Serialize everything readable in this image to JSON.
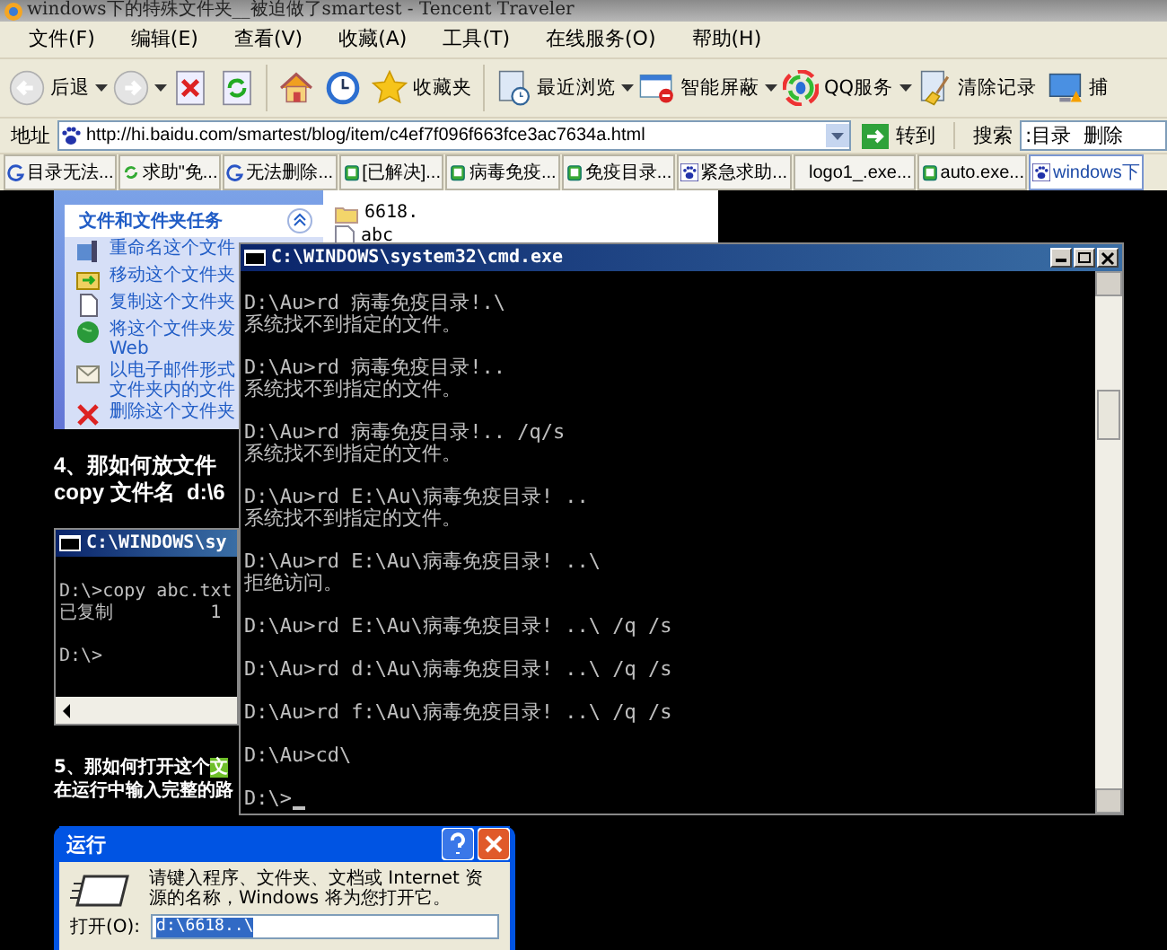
{
  "window": {
    "title": "windows下的特殊文件夹__被迫做了smartest - Tencent Traveler"
  },
  "menu": [
    "文件(F)",
    "编辑(E)",
    "查看(V)",
    "收藏(A)",
    "工具(T)",
    "在线服务(O)",
    "帮助(H)"
  ],
  "toolbar": [
    {
      "kind": "back",
      "label": "后退",
      "dropdown": true
    },
    {
      "kind": "forward",
      "dropdown": true
    },
    {
      "kind": "stop",
      "dropdown": false
    },
    {
      "kind": "refresh",
      "dropdown": false
    },
    {
      "kind": "home",
      "dropdown": false
    },
    {
      "kind": "history",
      "dropdown": false
    },
    {
      "kind": "favorites",
      "label": "收藏夹",
      "dropdown": false
    },
    {
      "kind": "recent",
      "label": "最近浏览",
      "dropdown": true
    },
    {
      "kind": "block",
      "label": "智能屏蔽",
      "dropdown": true
    },
    {
      "kind": "qq",
      "label": "QQ服务",
      "dropdown": true
    },
    {
      "kind": "clear",
      "label": "清除记录",
      "dropdown": false
    },
    {
      "kind": "capture",
      "label": "捕",
      "dropdown": false
    }
  ],
  "address_bar": {
    "label": "地址",
    "url": "http://hi.baidu.com/smartest/blog/item/c4ef7f096f663fce3ac7634a.html",
    "go": "转到",
    "search_label": "搜索",
    "search_value": ":目录  删除"
  },
  "tabs": [
    {
      "kind": "g",
      "label": "目录无法...",
      "selected": false
    },
    {
      "kind": "recycle",
      "label": "求助\"免...",
      "selected": false
    },
    {
      "kind": "g",
      "label": "无法删除...",
      "selected": false
    },
    {
      "kind": "page",
      "label": "[已解决]...",
      "selected": false
    },
    {
      "kind": "page",
      "label": "病毒免疫...",
      "selected": false
    },
    {
      "kind": "page",
      "label": "免疫目录...",
      "selected": false
    },
    {
      "kind": "paw",
      "label": "紧急求助...",
      "selected": false
    },
    {
      "kind": "none",
      "label": "logo1_.exe...",
      "selected": false
    },
    {
      "kind": "page",
      "label": "auto.exe...",
      "selected": false
    },
    {
      "kind": "paw",
      "label": "windows下",
      "selected": true
    }
  ],
  "article": {
    "explorer": {
      "task_header": "文件和文件夹任务",
      "expanded": true,
      "tasks": [
        {
          "kind": "rename",
          "label": "重命名这个文件"
        },
        {
          "kind": "move",
          "label": "移动这个文件夹"
        },
        {
          "kind": "copy",
          "label": "复制这个文件夹"
        },
        {
          "kind": "web",
          "label": "将这个文件夹发",
          "label_2": "Web"
        },
        {
          "kind": "email",
          "label": "以电子邮件形式",
          "label_2": "文件夹内的文件"
        },
        {
          "kind": "delete",
          "label": "删除这个文件夹"
        }
      ],
      "files": [
        {
          "kind": "folder",
          "name": "6618."
        },
        {
          "kind": "file",
          "name": "abc"
        }
      ]
    },
    "step4": {
      "heading": "4、那如何放文件",
      "command": "copy 文件名  d:\\6"
    },
    "small_console": {
      "title": "C:\\WINDOWS\\sy",
      "blocks": [
        [
          "D:\\>copy abc.txt",
          "已复制         1"
        ],
        [
          "D:\\>"
        ]
      ]
    },
    "step5": {
      "line_1": "5、那如何打开这个",
      "highlight": "文",
      "line_2": "在运行中输入完整的路"
    },
    "run_dialog": {
      "title": "运行",
      "prompt": "请键入程序、文件夹、文档或 Internet 资源的名称，Windows 将为您打开它。",
      "open_label": "打开(O):",
      "value": "d:\\6618..\\"
    },
    "console": {
      "title": "C:\\WINDOWS\\system32\\cmd.exe",
      "blocks": [
        [
          "D:\\Au>rd 病毒免疫目录!.\\",
          "系统找不到指定的文件。"
        ],
        [
          "D:\\Au>rd 病毒免疫目录!..",
          "系统找不到指定的文件。"
        ],
        [
          "D:\\Au>rd 病毒免疫目录!.. /q/s",
          "系统找不到指定的文件。"
        ],
        [
          "D:\\Au>rd E:\\Au\\病毒免疫目录! ..",
          "系统找不到指定的文件。"
        ],
        [
          "D:\\Au>rd E:\\Au\\病毒免疫目录! ..\\",
          "拒绝访问。"
        ],
        [
          "D:\\Au>rd E:\\Au\\病毒免疫目录! ..\\ /q /s"
        ],
        [
          "D:\\Au>rd d:\\Au\\病毒免疫目录! ..\\ /q /s"
        ],
        [
          "D:\\Au>rd f:\\Au\\病毒免疫目录! ..\\ /q /s"
        ],
        [
          "D:\\Au>cd\\"
        ],
        [
          "D:\\>"
        ]
      ]
    }
  }
}
